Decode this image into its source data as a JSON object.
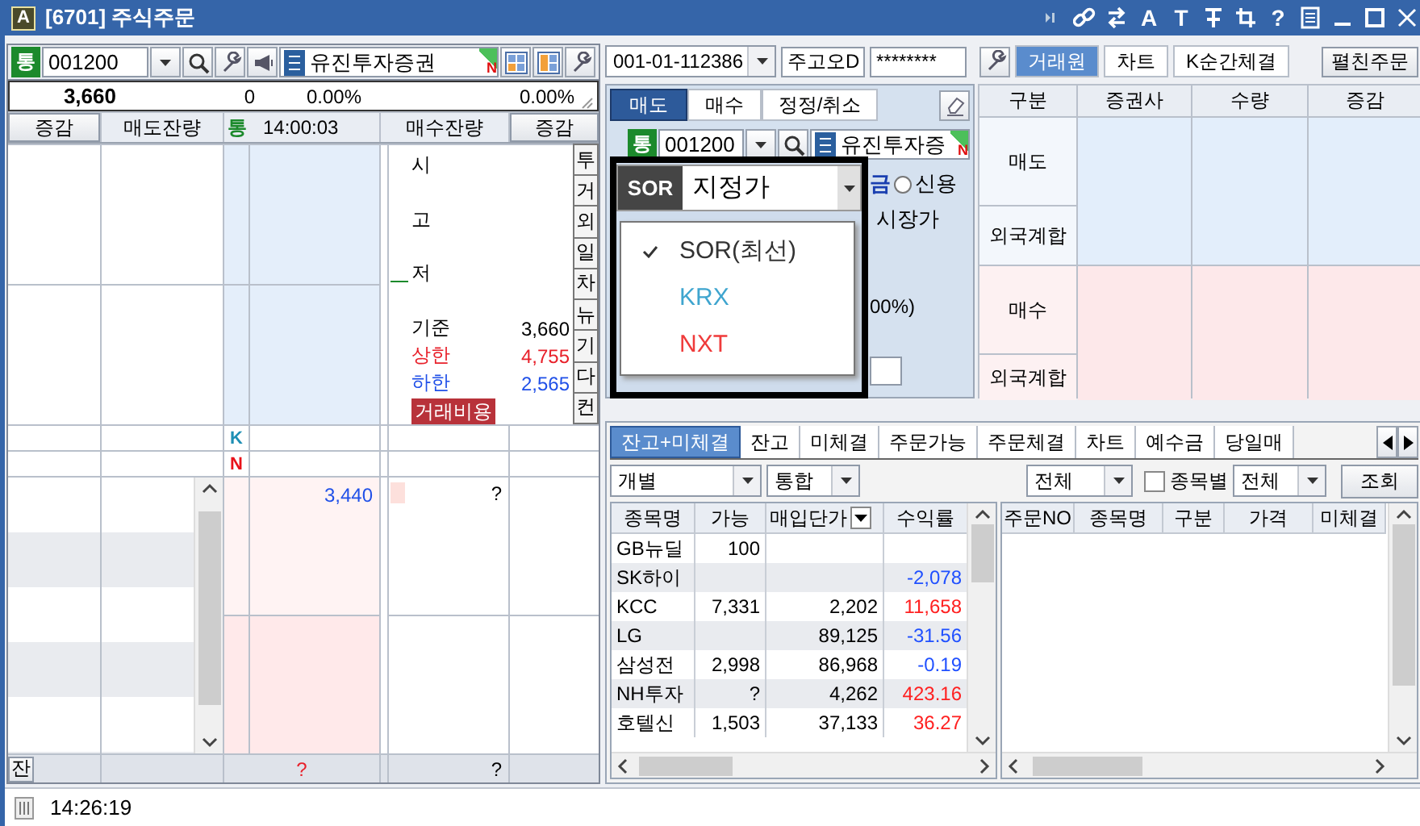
{
  "window": {
    "icon": "A",
    "title": "[6701] 주식주문"
  },
  "title_buttons": [
    {
      "kind": "skip"
    },
    {
      "kind": "link"
    },
    {
      "kind": "swap"
    },
    {
      "kind": "text",
      "label": "A"
    },
    {
      "kind": "text",
      "label": "T"
    },
    {
      "kind": "pin"
    },
    {
      "kind": "crop"
    },
    {
      "kind": "text",
      "label": "?"
    },
    {
      "kind": "list"
    },
    {
      "kind": "minimize"
    },
    {
      "kind": "maximize"
    },
    {
      "kind": "close"
    }
  ],
  "left": {
    "stock": {
      "market_badge": "통",
      "code": "001200",
      "name": "유진투자증권",
      "corner_mark": "N"
    },
    "quote": {
      "price": "3,660",
      "change": "0",
      "rate": "0.00%",
      "rate_2": "0.00%"
    },
    "header": {
      "left_button": "증감",
      "ask_label": "매도잔량",
      "market_badge": "통",
      "time": "14:00:03",
      "bid_label": "매수잔량",
      "right_button": "증감"
    },
    "info": [
      {
        "label": "시",
        "kind": "session"
      },
      {
        "label": "고",
        "kind": "session"
      },
      {
        "label": "저",
        "kind": "session",
        "marker": true
      },
      {
        "label": "기준",
        "value": "3,660",
        "kind": "reference"
      },
      {
        "label": "상한",
        "value": "4,755",
        "kind": "upper"
      },
      {
        "label": "하한",
        "value": "2,565",
        "kind": "lower"
      }
    ],
    "cost_button": "거래비용",
    "side_buttons": [
      "투",
      "거",
      "외",
      "일",
      "차",
      "뉴",
      "기",
      "다",
      "컨"
    ],
    "venue_marks": [
      {
        "label": "K",
        "color": "#1e8fb4"
      },
      {
        "label": "N",
        "color": "#e8121a"
      }
    ],
    "bid": {
      "price": "3,440",
      "quantity": "?"
    },
    "footer": {
      "button": "잔",
      "ask_total": "?",
      "bid_total": "?"
    }
  },
  "right": {
    "account": {
      "number": "001-01-112386",
      "name": "주고오D",
      "password": "********"
    },
    "top_tabs": [
      {
        "label": "거래원",
        "selected": true
      },
      {
        "label": "차트",
        "selected": false
      },
      {
        "label": "K순간체결",
        "selected": false
      }
    ],
    "expand_button": "펼친주문",
    "order_tabs": [
      {
        "label": "매도",
        "selected": true
      },
      {
        "label": "매수",
        "selected": false
      },
      {
        "label": "정정/취소",
        "selected": false
      }
    ],
    "order_stock": {
      "market_badge": "통",
      "code": "001200",
      "name": "유진투자증",
      "corner_mark": "N"
    },
    "order_type": {
      "venue_badge": "SOR",
      "value": "지정가"
    },
    "venue_menu": [
      {
        "label": "SOR(최선)",
        "checked": true,
        "color": "#333333"
      },
      {
        "label": "KRX",
        "checked": false,
        "color": "#3fa5cf"
      },
      {
        "label": "NXT",
        "checked": false,
        "color": "#ef3b3b"
      }
    ],
    "account_kind": {
      "cash_tail": "금",
      "credit": {
        "label": "신용",
        "selected": false
      }
    },
    "market_price_label": "시장가",
    "ratio_fragment": "00%)",
    "broker_table": {
      "columns": [
        "구분",
        "증권사",
        "수량",
        "증감"
      ],
      "rows": [
        {
          "label": "매도",
          "kind": "sell"
        },
        {
          "label": "외국계합",
          "kind": "sell"
        },
        {
          "label": "매수",
          "kind": "buy"
        },
        {
          "label": "외국계합",
          "kind": "buy"
        }
      ]
    },
    "bottom_tabs": [
      {
        "label": "잔고+미체결",
        "selected": true
      },
      {
        "label": "잔고",
        "selected": false
      },
      {
        "label": "미체결",
        "selected": false
      },
      {
        "label": "주문가능",
        "selected": false
      },
      {
        "label": "주문체결",
        "selected": false
      },
      {
        "label": "차트",
        "selected": false
      },
      {
        "label": "예수금",
        "selected": false
      },
      {
        "label": "당일매",
        "selected": false
      }
    ],
    "filters": {
      "account_mode": "개별",
      "merge_mode": "통합",
      "scope": "전체",
      "by_stock": {
        "label": "종목별",
        "checked": false
      },
      "scope_2": "전체",
      "query_button": "조회"
    },
    "holdings": {
      "columns": [
        {
          "label": "종목명"
        },
        {
          "label": "가능"
        },
        {
          "label": "매입단가",
          "menu": true
        },
        {
          "label": "수익률"
        }
      ],
      "rows": [
        {
          "name": "GB뉴딜",
          "available": "100"
        },
        {
          "name": "SK하이",
          "return": "-2,078",
          "color": "#2050ff"
        },
        {
          "name": "KCC",
          "available": "7,331",
          "avg_price": "2,202",
          "return": "11,658",
          "color": "#ff2020"
        },
        {
          "name": "LG",
          "avg_price": "89,125",
          "return": "-31.56",
          "color": "#2050ff"
        },
        {
          "name": "삼성전",
          "available": "2,998",
          "avg_price": "86,968",
          "return": "-0.19",
          "color": "#2050ff"
        },
        {
          "name": "NH투자",
          "available": "?",
          "avg_price": "4,262",
          "return": "423.16",
          "color": "#ff2020"
        },
        {
          "name": "호텔신",
          "available": "1,503",
          "avg_price": "37,133",
          "return": "36.27",
          "color": "#ff2020"
        }
      ]
    },
    "orders": {
      "columns": [
        "주문NO",
        "종목명",
        "구분",
        "가격",
        "미체결"
      ]
    }
  },
  "status_bar": {
    "time": "14:26:19"
  }
}
